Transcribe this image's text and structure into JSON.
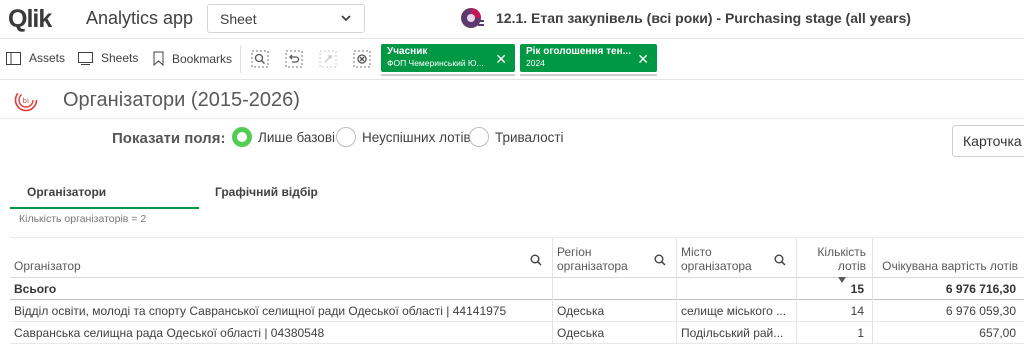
{
  "app": {
    "logo_text": "Qlik",
    "name": "Analytics app",
    "sheet_selector": "Sheet",
    "sheet_title": "12.1. Етап закупівель (всі роки) - Purchasing stage (all years)",
    "more": "···"
  },
  "toolbar": {
    "assets": "Assets",
    "sheets": "Sheets",
    "bookmarks": "Bookmarks",
    "selections": [
      {
        "label": "Учасник",
        "value": "ФОП Чемеринський Ю..."
      },
      {
        "label": "Рік оголошення тен...",
        "value": "2024"
      }
    ],
    "accent_color": "#009845"
  },
  "page": {
    "title": "Організатори (2015-2026)"
  },
  "show_fields": {
    "label": "Показати поля:",
    "options": [
      {
        "label": "Лише базові",
        "selected": true
      },
      {
        "label": "Неуспішних лотів",
        "selected": false
      },
      {
        "label": "Тривалості",
        "selected": false
      }
    ],
    "selected_color": "#52cc52",
    "card_button": "Карточка"
  },
  "tabs": [
    {
      "label": "Організатори",
      "active": true
    },
    {
      "label": "Графічний відбір",
      "active": false
    }
  ],
  "count_text": "Кількість організаторів = 2",
  "table": {
    "columns": [
      {
        "label": "Організатор",
        "searchable": true
      },
      {
        "label_line1": "Регіон",
        "label_line2": "організатора",
        "searchable": true
      },
      {
        "label_line1": "Місто",
        "label_line2": "організатора",
        "searchable": true
      },
      {
        "label_line1": "Кількість",
        "label_line2": "лотів",
        "sorted": "desc"
      },
      {
        "label": "Очікувана вартість лотів"
      }
    ],
    "total": {
      "label": "Всього",
      "region": "",
      "city": "",
      "lots": "15",
      "value": "6 976 716,30"
    },
    "rows": [
      {
        "organizer": "Відділ освіти, молоді та спорту Савранської селищної ради Одеської області | 44141975",
        "region": "Одеська",
        "city": "селище міського ...",
        "lots": "14",
        "value": "6 976 059,30"
      },
      {
        "organizer": "Савранська селищна рада Одеської області | 04380548",
        "region": "Одеська",
        "city": "Подільський рай...",
        "lots": "1",
        "value": "657,00"
      }
    ]
  }
}
